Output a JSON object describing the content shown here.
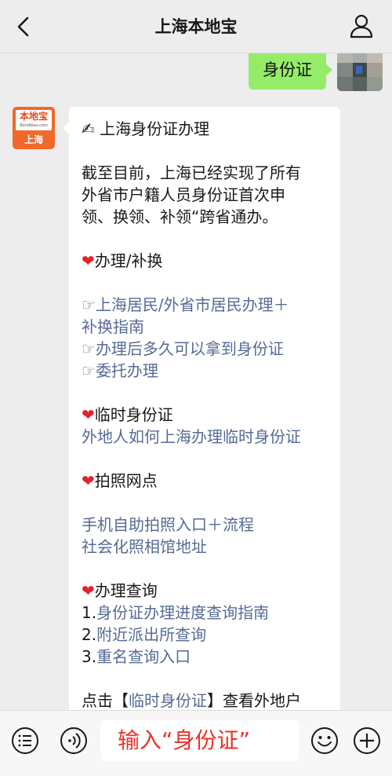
{
  "header": {
    "title": "上海本地宝",
    "back_icon": "chevron-left-icon",
    "profile_icon": "person-icon"
  },
  "outgoing_message": {
    "text": "身份证"
  },
  "bot_avatar": {
    "name": "本地宝",
    "url": "Bendibao.com",
    "city": "上海"
  },
  "incoming_message": {
    "title": "✍ 上海身份证办理",
    "intro": [
      "截至目前，上海已经实现了所有",
      "外省市户籍人员身份证首次申",
      "领、换领、补领“跨省通办。"
    ],
    "sections": [
      {
        "heading": "办理/补换",
        "lines": [
          {
            "prefix": "☞",
            "text": "上海居民/外省市居民办理＋"
          },
          {
            "prefix": "",
            "text": "补换指南"
          },
          {
            "prefix": "☞",
            "text": "办理后多久可以拿到身份证"
          },
          {
            "prefix": "☞",
            "text": "委托办理"
          }
        ]
      },
      {
        "heading": "临时身份证",
        "lines": [
          {
            "prefix": "",
            "text": "外地人如何上海办理临时身份证"
          }
        ]
      },
      {
        "heading": "拍照网点",
        "lines": [
          {
            "prefix": "",
            "text": "手机自助拍照入口＋流程"
          },
          {
            "prefix": "",
            "text": "社会化照相馆地址"
          }
        ]
      },
      {
        "heading": "办理查询",
        "lines": [
          {
            "prefix": "1.",
            "text": "身份证办理进度查询指南"
          },
          {
            "prefix": "2.",
            "text": "附近派出所查询"
          },
          {
            "prefix": "3.",
            "text": "重名查询入口"
          }
        ]
      }
    ],
    "footer": {
      "before": "点击【",
      "link": "临时身份证",
      "after": "】查看外地户"
    }
  },
  "input_bar": {
    "menu_icon": "menu-list-icon",
    "voice_icon": "voice-icon",
    "hint": "输入“身份证”",
    "emoji_icon": "emoji-icon",
    "plus_icon": "plus-icon"
  },
  "colors": {
    "bubble_green": "#95ec69",
    "link": "#576b95",
    "hint_red": "#e8342a",
    "avatar_orange": "#f0692a"
  }
}
